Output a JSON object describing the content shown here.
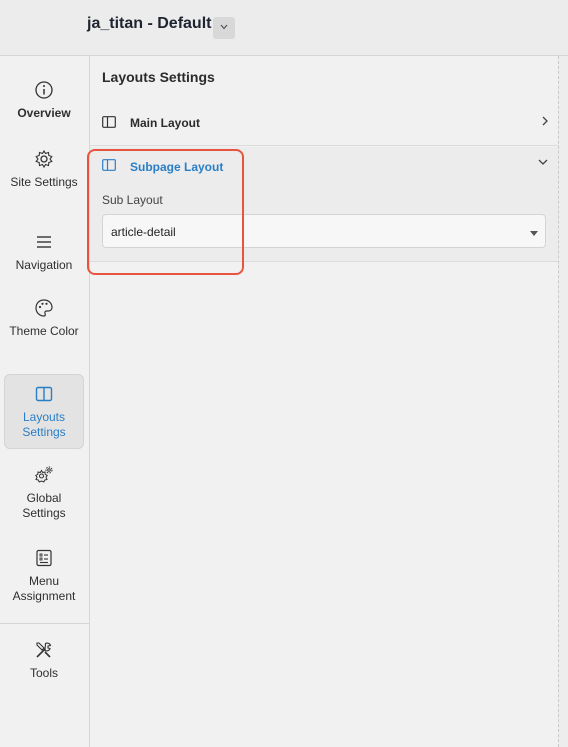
{
  "header": {
    "title": "ja_titan - Default"
  },
  "sidebar": {
    "items": [
      {
        "label": "Overview",
        "icon": "info-circle-icon"
      },
      {
        "label": "Site Settings",
        "icon": "gear-icon"
      },
      {
        "label": "Navigation",
        "icon": "hamburger-menu-icon"
      },
      {
        "label": "Theme Color",
        "icon": "palette-icon"
      },
      {
        "label": "Layouts Settings",
        "icon": "layout-columns-icon",
        "active": true
      },
      {
        "label": "Global Settings",
        "icon": "gears-icon"
      },
      {
        "label": "Menu Assignment",
        "icon": "checklist-icon"
      },
      {
        "label": "Tools",
        "icon": "tools-icon"
      }
    ]
  },
  "main": {
    "heading": "Layouts Settings",
    "sections": [
      {
        "label": "Main Layout",
        "expanded": false
      },
      {
        "label": "Subpage Layout",
        "expanded": true
      }
    ],
    "sub_layout": {
      "label": "Sub Layout",
      "value": "article-detail"
    }
  },
  "colors": {
    "accent": "#2a7ec6",
    "highlight": "#e8553e"
  }
}
